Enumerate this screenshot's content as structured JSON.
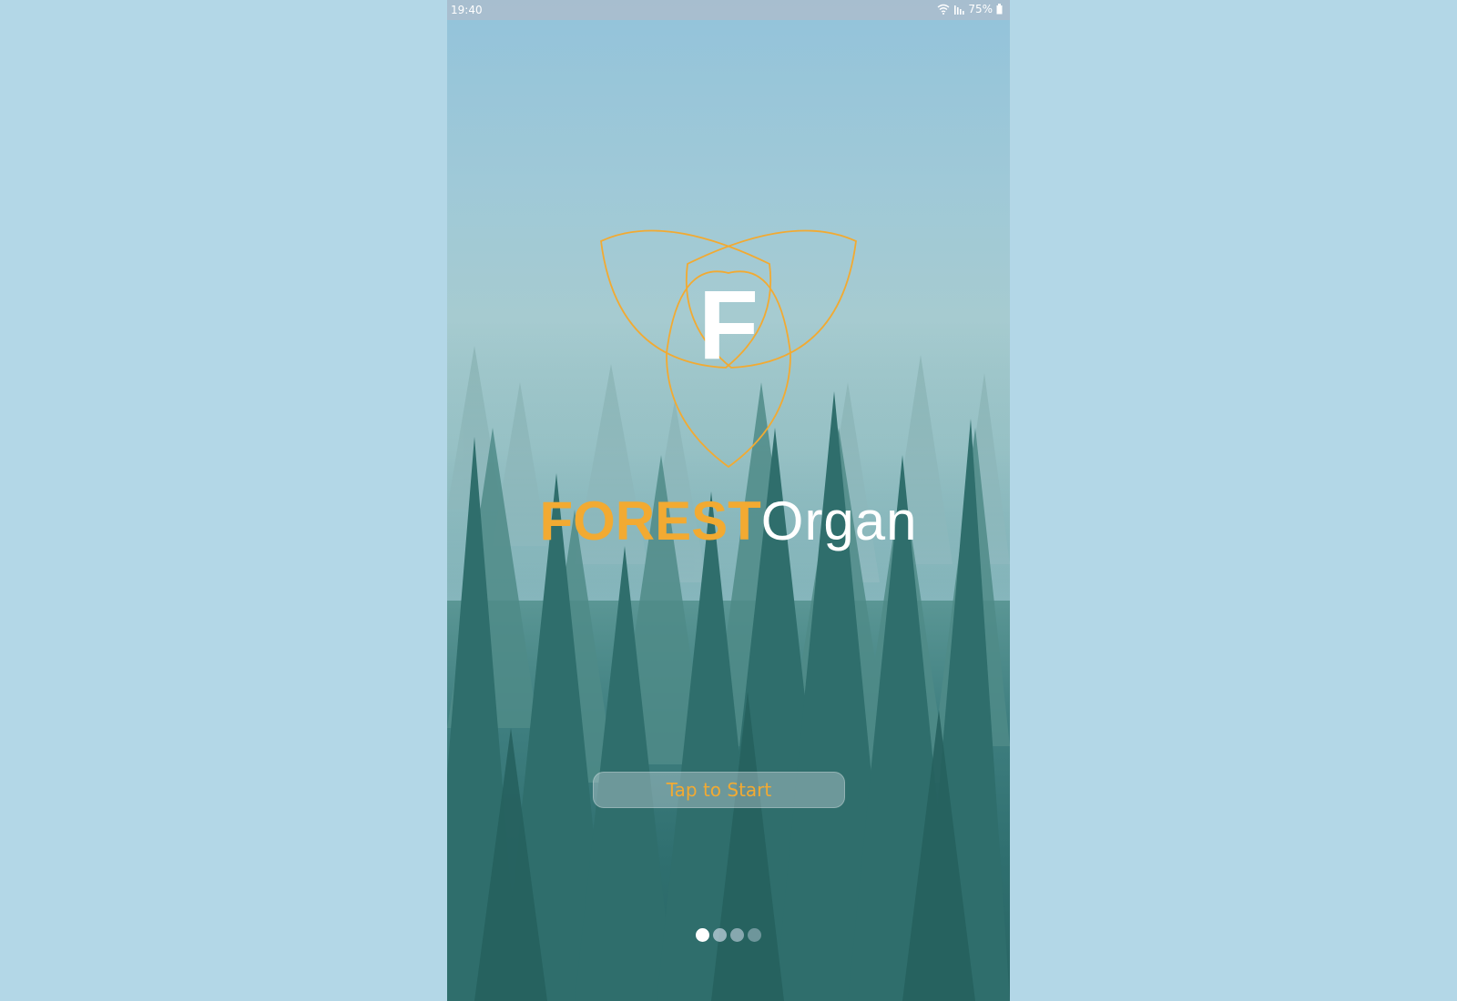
{
  "status_bar": {
    "time": "19:40",
    "battery": "75%",
    "icons": [
      "wifi-icon",
      "signal-icon",
      "battery-icon"
    ]
  },
  "logo": {
    "letter": "F",
    "accent_color": "#f2aa32"
  },
  "brand": {
    "bold_part": "FOREST",
    "light_part": "Organ"
  },
  "start_button": {
    "label": "Tap to Start"
  },
  "pager": {
    "total": 4,
    "active_index": 0
  },
  "background": {
    "page_color": "#b3d7e7"
  }
}
